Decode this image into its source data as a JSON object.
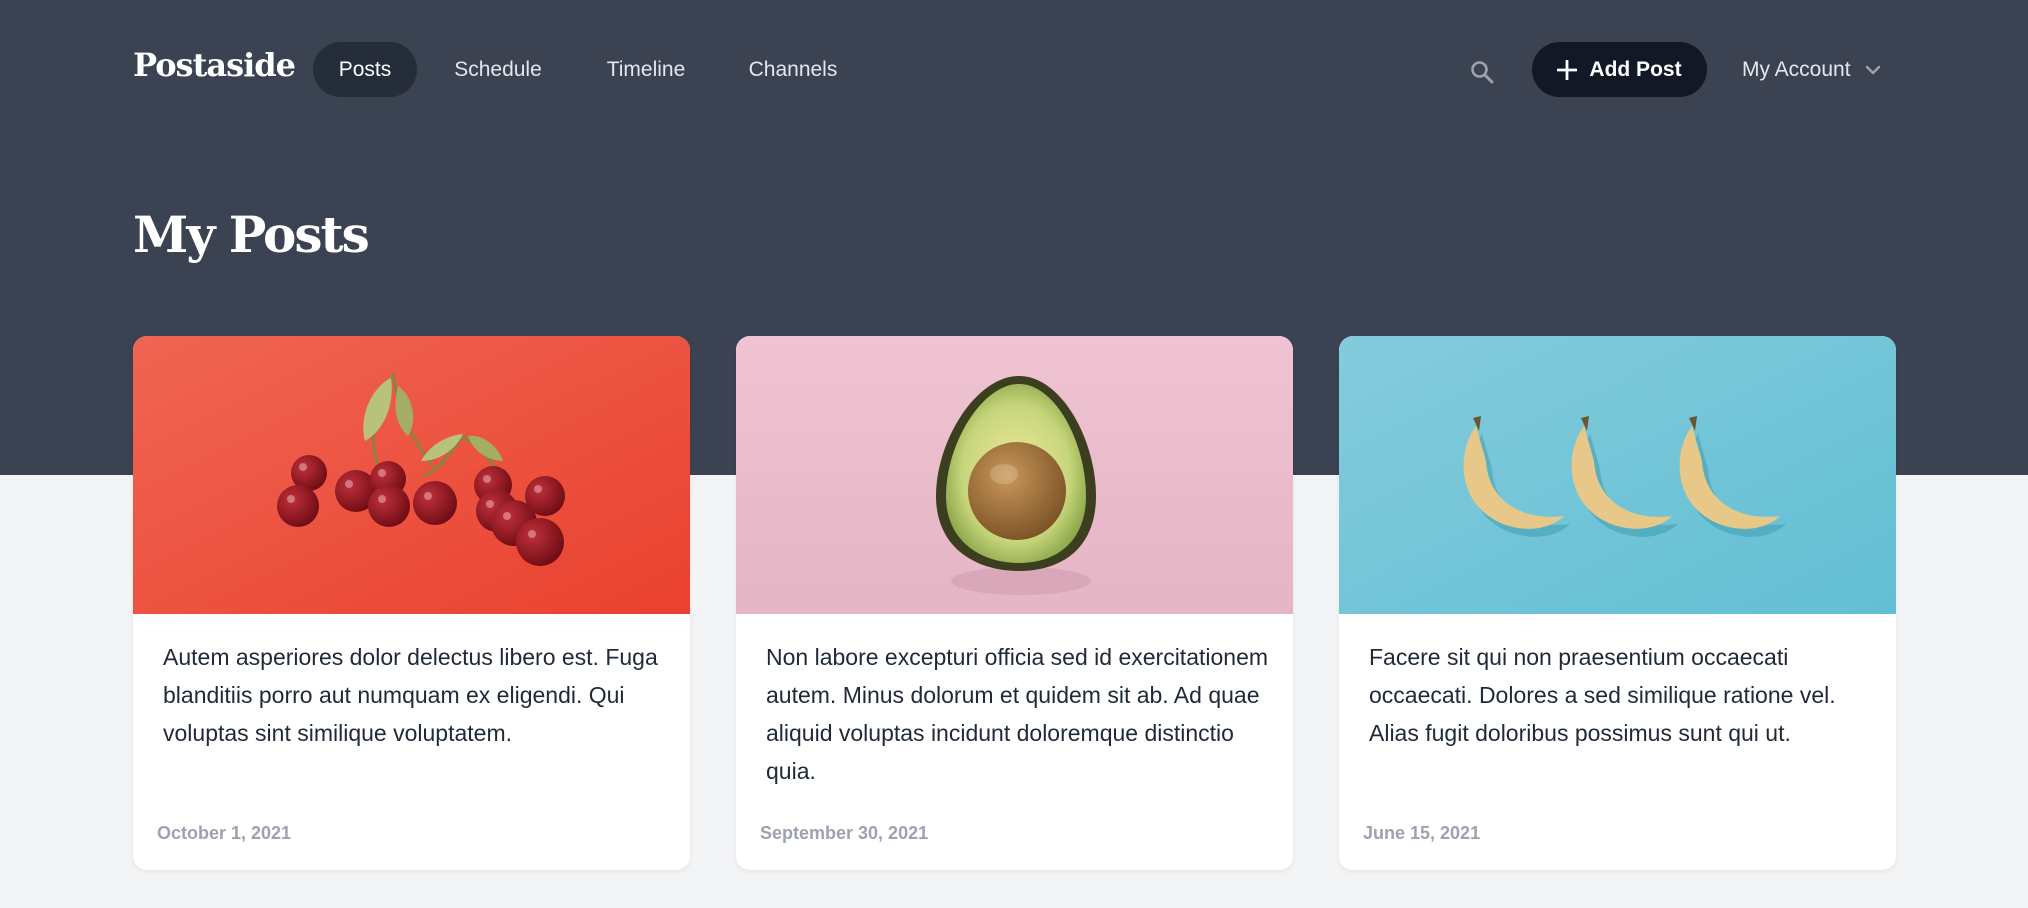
{
  "app": {
    "logo": "Postaside"
  },
  "nav": {
    "items": [
      {
        "label": "Posts",
        "active": true
      },
      {
        "label": "Schedule",
        "active": false
      },
      {
        "label": "Timeline",
        "active": false
      },
      {
        "label": "Channels",
        "active": false
      }
    ],
    "search_icon": "search-icon",
    "add_post_label": "Add Post",
    "add_icon": "plus-icon",
    "account_label": "My Account",
    "account_icon": "chevron-down-icon"
  },
  "page": {
    "title": "My Posts"
  },
  "posts": [
    {
      "image": "cherries on red background",
      "text": "Autem asperiores dolor delectus libero est. Fuga blanditiis porro aut numquam ex eligendi. Qui voluptas sint similique voluptatem.",
      "date": "October 1, 2021"
    },
    {
      "image": "avocado half on pink background",
      "text": "Non labore excepturi officia sed id exercitationem autem. Minus dolorum et quidem sit ab. Ad quae aliquid voluptas incidunt doloremque distinctio quia.",
      "date": "September 30, 2021"
    },
    {
      "image": "three bananas on blue background",
      "text": "Facere sit qui non praesentium occaecati occaecati. Dolores a sed similique ratione vel. Alias fugit doloribus possimus sunt qui ut.",
      "date": "June 15, 2021"
    }
  ],
  "colors": {
    "header_bg": "#3b4252",
    "active_nav_bg": "#252c3a",
    "add_button_bg": "#121826",
    "page_bg": "#f3f4f6",
    "card1_bg": "#ee5745",
    "card2_bg": "#ebbccc",
    "card3_bg": "#74c6d8"
  }
}
